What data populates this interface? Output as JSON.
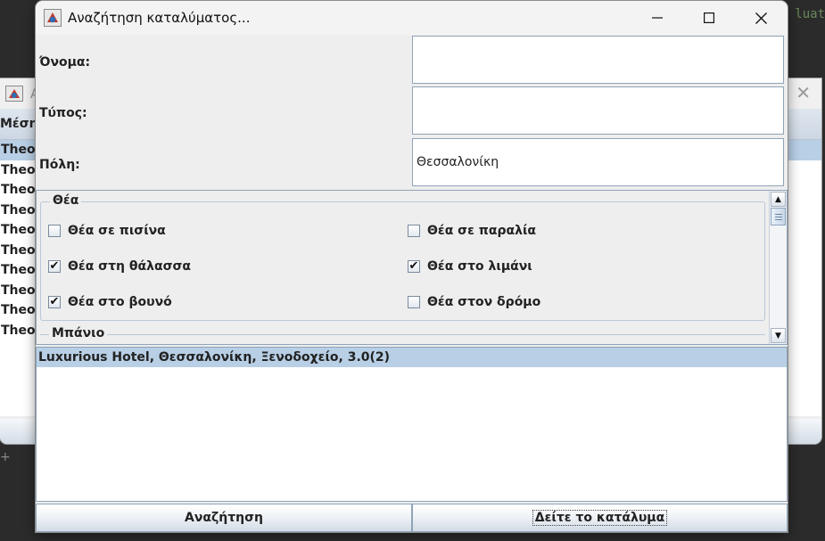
{
  "background": {
    "code_fragment": "luat",
    "plus_glyph": "+",
    "window_title": "A",
    "header_label": "Μέση",
    "list_rows": [
      "Theot",
      "Theot",
      "Theot",
      "Theot",
      "Theot",
      "Theot",
      "Theot",
      "Theot",
      "Theot",
      "Theot"
    ]
  },
  "window": {
    "title": "Αναζήτηση καταλύματος...",
    "icons": [
      "java-app-icon",
      "minimize-icon",
      "maximize-icon",
      "close-icon"
    ]
  },
  "form": {
    "name_label": "Όνομα:",
    "name_value": "",
    "type_label": "Τύπος:",
    "type_value": "",
    "city_label": "Πόλη:",
    "city_value": "Θεσσαλονίκη"
  },
  "filters": {
    "view_group_title": "Θέα",
    "view_options": [
      {
        "label": "Θέα σε πισίνα",
        "checked": false
      },
      {
        "label": "Θέα σε παραλία",
        "checked": false
      },
      {
        "label": "Θέα στη θάλασσα",
        "checked": true
      },
      {
        "label": "Θέα στο λιμάνι",
        "checked": true
      },
      {
        "label": "Θέα στο βουνό",
        "checked": true
      },
      {
        "label": "Θέα στον δρόμο",
        "checked": false
      }
    ],
    "bath_group_title": "Μπάνιο"
  },
  "results": [
    "Luxurious Hotel, Θεσσαλονίκη, Ξενοδοχείο, 3.0(2)"
  ],
  "buttons": {
    "search": "Αναζήτηση",
    "view": "Δείτε το κατάλυμα"
  },
  "check_glyph": "✔"
}
